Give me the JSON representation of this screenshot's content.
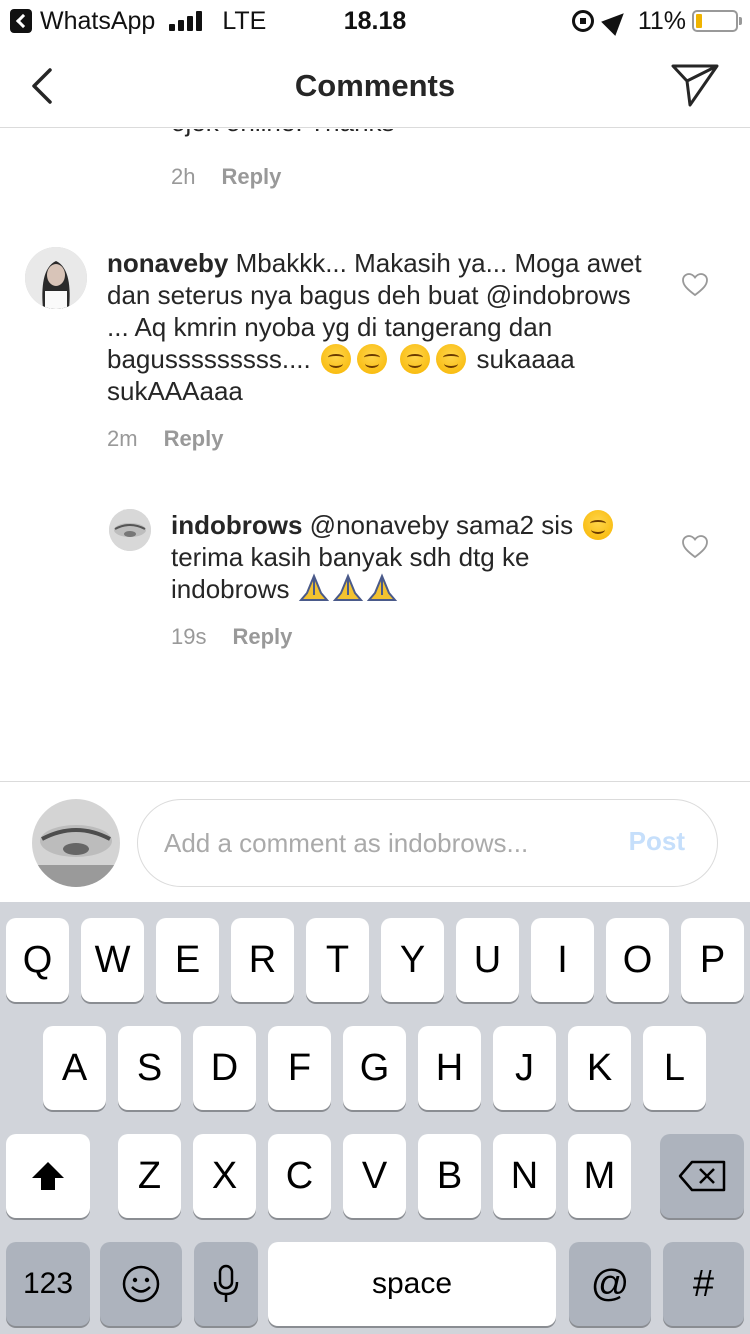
{
  "status_bar": {
    "back_app": "WhatsApp",
    "network": "LTE",
    "time": "18.18",
    "battery": "11%"
  },
  "nav": {
    "title": "Comments",
    "back_icon": "chevron-left-icon",
    "share_icon": "paper-plane-icon"
  },
  "comments": [
    {
      "partial_text": "ojek online. Thanks",
      "time": "2h",
      "reply_label": "Reply"
    },
    {
      "username": "nonaveby",
      "text_1": "Mbakkk... Makasih ya... Moga awet dan seterus nya bagus deh buat @indobrows ... Aq kmrin nyoba yg di tangerang dan bagusssssssss....",
      "text_2": "sukaaaa sukAAAaaa",
      "time": "2m",
      "reply_label": "Reply"
    },
    {
      "username": "indobrows",
      "text_1": "@nonaveby sama2 sis",
      "text_2": "terima kasih banyak sdh dtg ke indobrows",
      "time": "19s",
      "reply_label": "Reply"
    }
  ],
  "composer": {
    "placeholder": "Add a comment as indobrows...",
    "post_label": "Post"
  },
  "keyboard": {
    "row1": [
      "Q",
      "W",
      "E",
      "R",
      "T",
      "Y",
      "U",
      "I",
      "O",
      "P"
    ],
    "row2": [
      "A",
      "S",
      "D",
      "F",
      "G",
      "H",
      "J",
      "K",
      "L"
    ],
    "row3": [
      "Z",
      "X",
      "C",
      "V",
      "B",
      "N",
      "M"
    ],
    "numbers_label": "123",
    "space_label": "space",
    "at_label": "@",
    "hash_label": "#"
  }
}
